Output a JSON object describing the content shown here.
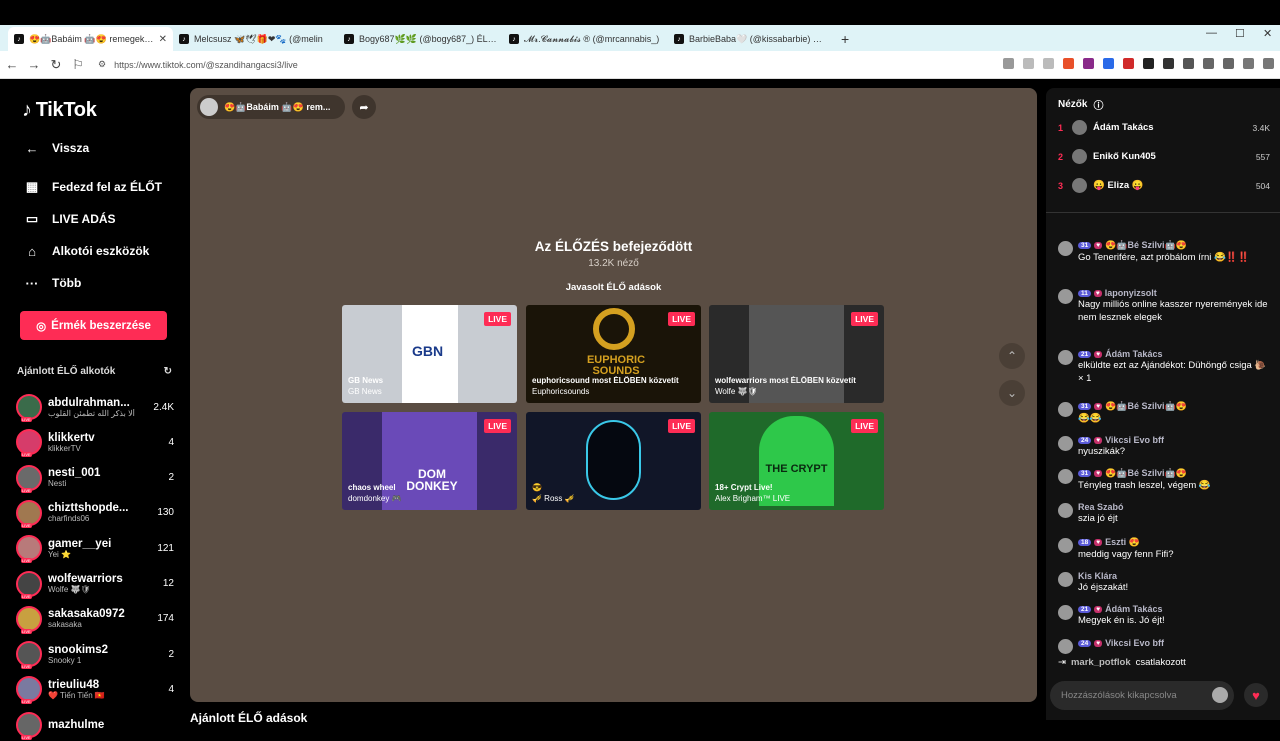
{
  "browser": {
    "tabs": [
      {
        "title": "😍🤖Babáim 🤖😍 remegek 😍",
        "active": true
      },
      {
        "title": "Melcsusz 🦋🕊🎁❤🐾 (@melin",
        "active": false
      },
      {
        "title": "Bogy687🌿🌿 (@bogy687_) ÉLŐ a",
        "active": false
      },
      {
        "title": "𝓜𝓻.𝓒𝓪𝓷𝓷𝓪𝓫𝓲𝓼 ® (@mrcannabis_)",
        "active": false
      },
      {
        "title": "BarbieBaba🤍 (@kissabarbie) ÉLŐ ad",
        "active": false
      }
    ],
    "new_tab": "+",
    "url": "https://www.tiktok.com/@szandihangacsi3/live"
  },
  "sidebar": {
    "logo": "TikTok",
    "back": "Vissza",
    "nav": [
      {
        "label": "Fedezd fel az ÉLŐT",
        "icon": "calendar-icon"
      },
      {
        "label": "LIVE ADÁS",
        "icon": "video-icon"
      },
      {
        "label": "Alkotói eszközök",
        "icon": "creator-tools-icon"
      },
      {
        "label": "Több",
        "icon": "more-icon"
      }
    ],
    "coin_button": "Érmék beszerzése",
    "recommended_title": "Ajánlott ÉLŐ alkotók",
    "creators": [
      {
        "name": "abdulrahman...",
        "sub": "ألا بذكر الله تطمئن القلوب",
        "count": "2.4K",
        "color": "#3a6b4a"
      },
      {
        "name": "klikkertv",
        "sub": "klikkerTV",
        "count": "4",
        "color": "#d63c6a"
      },
      {
        "name": "nesti_001",
        "sub": "Nesti",
        "count": "2",
        "color": "#6a6a6a"
      },
      {
        "name": "chizttshopde...",
        "sub": "charfinds06",
        "count": "130",
        "color": "#a07850"
      },
      {
        "name": "gamer__yei",
        "sub": "Yei ⭐",
        "count": "121",
        "color": "#b87a7a"
      },
      {
        "name": "wolfewarriors",
        "sub": "Wolfe 🐺🛡",
        "count": "12",
        "color": "#444"
      },
      {
        "name": "sakasaka0972",
        "sub": "sakasaka",
        "count": "174",
        "color": "#c8a040"
      },
      {
        "name": "snookims2",
        "sub": "Snooky 1",
        "count": "2",
        "color": "#555"
      },
      {
        "name": "trieuliu48",
        "sub": "❤️ Tiến Tiến 🇻🇳",
        "count": "4",
        "color": "#7a7aa0"
      },
      {
        "name": "mazhulme",
        "sub": "",
        "count": "",
        "color": "#666"
      }
    ]
  },
  "main": {
    "host_name": "😍🤖Babáim 🤖😍 rem...",
    "ended_title": "Az ÉLŐZÉS befejeződött",
    "viewers": "13.2K néző",
    "recommended_label": "Javasolt ÉLŐ adások",
    "live_badge": "LIVE",
    "cards": [
      {
        "title": "GB News",
        "sub": "GB News",
        "bg": "#c8ccd2"
      },
      {
        "title": "euphoricsound most ÉLŐBEN közvetít",
        "sub": "Euphoricsounds",
        "bg": "#1a1408"
      },
      {
        "title": "wolfewarriors most ÉLŐBEN közvetít",
        "sub": "Wolfe 🐺🛡",
        "bg": "#2a2a2a"
      },
      {
        "title": "chaos wheel",
        "sub": "domdonkey 🎮",
        "bg": "#3a2a6a"
      },
      {
        "title": "😎",
        "sub": "🎺 Ross 🎺",
        "bg": "#111628"
      },
      {
        "title": "18+ Crypt Live!",
        "sub": "Alex Brigham™ LIVE",
        "bg": "#1f6a2a"
      }
    ],
    "card_art": [
      "GBN",
      "EUPHORIC SOUNDS",
      "",
      "DOM DONKEY",
      "",
      "THE CRYPT"
    ],
    "bottom_title": "Ajánlott ÉLŐ adások"
  },
  "chat": {
    "viewers_title": "Nézők",
    "top_viewers": [
      {
        "rank": "1",
        "name": "Ádám Takács",
        "count": "3.4K"
      },
      {
        "rank": "2",
        "name": "Enikő Kun405",
        "count": "557"
      },
      {
        "rank": "3",
        "name": "😛 Eliza 😛",
        "count": "504"
      }
    ],
    "messages": [
      {
        "badge": "31",
        "user": "😍🤖Bé Szilvi🤖😍",
        "text": "Go Tenerifére, azt próbálom írni 😂‼️‼️"
      },
      {
        "badge": "11",
        "user": "laponyizsolt",
        "text": "Nagy milliós online kasszer nyeremények ide nem lesznek elegek"
      },
      {
        "badge": "21",
        "user": "Ádám Takács",
        "text": "elküldte ezt az Ajándékot: Dühöngő csiga 🐌 × 1"
      },
      {
        "badge": "31",
        "user": "😍🤖Bé Szilvi🤖😍",
        "text": "😂😂"
      },
      {
        "badge": "24",
        "user": "Vikcsi Evo bff",
        "text": "nyuszikák?"
      },
      {
        "badge": "31",
        "user": "😍🤖Bé Szilvi🤖😍",
        "text": "Tényleg trash leszel, végem 😂"
      },
      {
        "badge": "",
        "user": "Rea Szabó",
        "text": "szia jó éjt"
      },
      {
        "badge": "18",
        "user": "Eszti 😍",
        "text": "meddig vagy fenn Fifi?"
      },
      {
        "badge": "",
        "user": "Kis Klára",
        "text": "Jó éjszakát!"
      },
      {
        "badge": "21",
        "user": "Ádám Takács",
        "text": "Megyek én is. Jó éjt!"
      },
      {
        "badge": "24",
        "user": "Vikcsi Evo bff",
        "text": ""
      }
    ],
    "joined_user": "mark_potflok",
    "joined_text": "csatlakozott",
    "comment_placeholder": "Hozzászólások kikapcsolva"
  }
}
